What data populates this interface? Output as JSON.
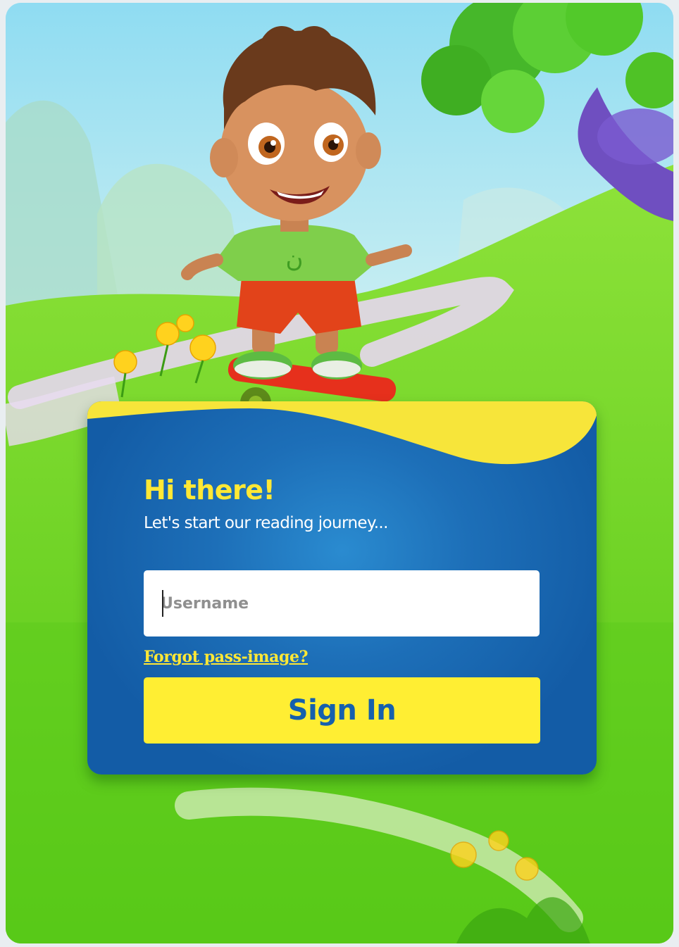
{
  "login": {
    "greeting": "Hi there!",
    "subtitle": "Let's start our reading journey...",
    "username_placeholder": "Username",
    "username_value": "",
    "forgot_link": "Forgot pass-image?",
    "signin_label": "Sign In"
  },
  "mascot": {
    "shirt_logo": "ﻥ"
  },
  "colors": {
    "card_blue": "#135ca6",
    "accent_yellow": "#ffee33",
    "button_text_blue": "#1560ad",
    "grass_green": "#5ccb1b"
  }
}
